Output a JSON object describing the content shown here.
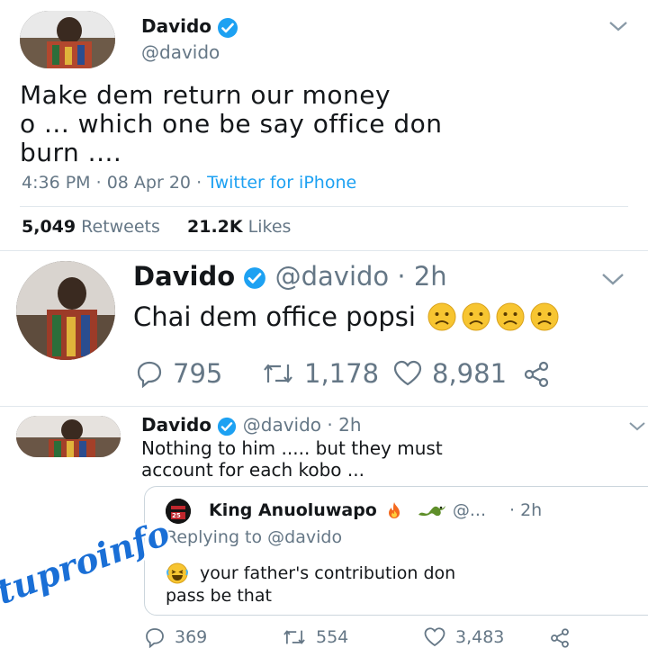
{
  "tweet1": {
    "name": "Davido",
    "handle": "@davido",
    "text_line1": "Make  dem return our money",
    "text_line2": "o ... which one be say office don",
    "text_line3": "burn ....",
    "time": "4:36 PM",
    "sep1": "·",
    "date": "08 Apr 20",
    "sep2": "·",
    "source": "Twitter for iPhone",
    "retweets_count": "5,049",
    "retweets_label": "Retweets",
    "likes_count": "21.2K",
    "likes_label": "Likes"
  },
  "tweet2": {
    "name": "Davido",
    "handle": "@davido · 2h",
    "text": "Chai dem office popsi",
    "replies": "795",
    "retweets": "1,178",
    "likes": "8,981"
  },
  "tweet3": {
    "name": "Davido",
    "handle": "@davido · 2h",
    "text_line1": "Nothing to him ..... but they must",
    "text_line2": "account for each kobo ...",
    "replies": "369",
    "retweets": "554",
    "likes": "3,483"
  },
  "quoted": {
    "name": "King Anuoluwapo",
    "handle": "@...",
    "time": "· 2h",
    "replying": "Replying to @davido",
    "text_line1": "your father's contribution don",
    "text_line2": "pass be that",
    "avatar_badge": "25"
  },
  "watermark": "tuproinfo",
  "icons": [
    "verified-icon",
    "chevron-down-icon",
    "reply-icon",
    "retweet-icon",
    "like-icon",
    "share-icon",
    "sad-face-icon",
    "laughing-face-icon",
    "fire-icon",
    "dragon-icon"
  ],
  "colors": {
    "link": "#1da1f2",
    "muted": "#657786",
    "verified": "#1da1f2",
    "watermark": "#1a6fd6"
  }
}
